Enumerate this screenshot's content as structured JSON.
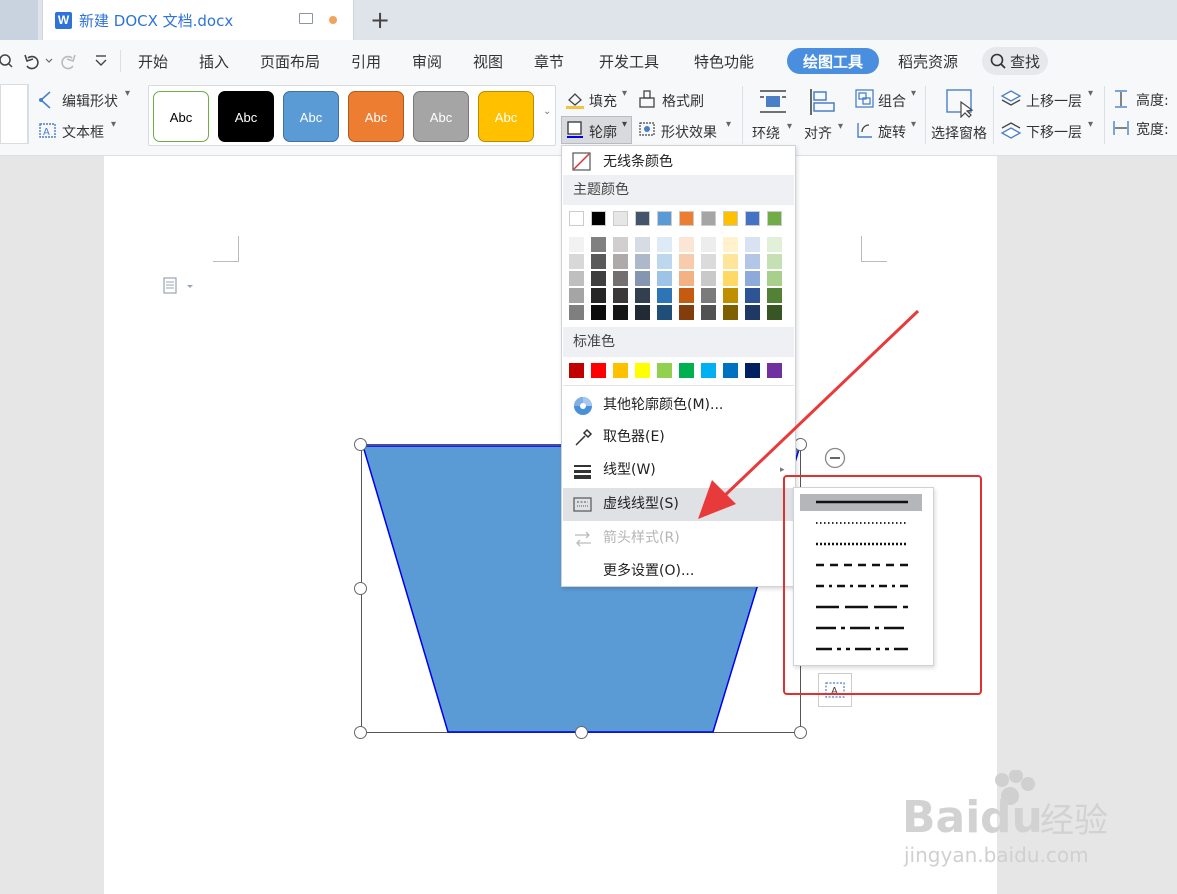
{
  "window": {
    "tab_title": "新建 DOCX 文档.docx",
    "new_tab_symbol": "+"
  },
  "menu": {
    "items": [
      "开始",
      "插入",
      "页面布局",
      "引用",
      "审阅",
      "视图",
      "章节",
      "开发工具",
      "特色功能",
      "绘图工具",
      "稻壳资源"
    ],
    "active": "绘图工具",
    "search_label": "查找"
  },
  "ribbon": {
    "edit_shape": "编辑形状",
    "text_box": "文本框",
    "style_label": "Abc",
    "fill": "填充",
    "format_painter": "格式刷",
    "outline": "轮廓",
    "shape_effect": "形状效果",
    "wrap": "环绕",
    "align": "对齐",
    "group": "组合",
    "rotate": "旋转",
    "selection_pane": "选择窗格",
    "bring_forward": "上移一层",
    "send_backward": "下移一层",
    "height": "高度:",
    "width": "宽度:"
  },
  "style_swatches": [
    {
      "bg": "#ffffff",
      "fg": "#000000",
      "border": "#70ad47"
    },
    {
      "bg": "#000000",
      "fg": "#ffffff",
      "border": "#000000"
    },
    {
      "bg": "#5b9bd5",
      "fg": "#ffffff",
      "border": "#41719c"
    },
    {
      "bg": "#ed7d31",
      "fg": "#ffffff",
      "border": "#ae5a21"
    },
    {
      "bg": "#a5a5a5",
      "fg": "#ffffff",
      "border": "#787878"
    },
    {
      "bg": "#ffc000",
      "fg": "#ffffff",
      "border": "#bc8c00"
    }
  ],
  "outline_menu": {
    "no_line": "无线条颜色",
    "theme_colors": "主题颜色",
    "standard_colors": "标准色",
    "more_colors": "其他轮廓颜色(M)...",
    "eyedropper": "取色器(E)",
    "line_type": "线型(W)",
    "dash_type": "虚线线型(S)",
    "arrow_style": "箭头样式(R)",
    "more_settings": "更多设置(O)..."
  },
  "theme_top": [
    "#ffffff",
    "#000000",
    "#e7e6e6",
    "#44546a",
    "#5b9bd5",
    "#ed7d31",
    "#a5a5a5",
    "#ffc000",
    "#4472c4",
    "#70ad47"
  ],
  "theme_shades": [
    [
      "#f2f2f2",
      "#808080",
      "#d0cece",
      "#d6dce4",
      "#deebf6",
      "#fbe5d5",
      "#ededed",
      "#fff2cc",
      "#d9e2f3",
      "#e2efd9"
    ],
    [
      "#d8d8d8",
      "#595959",
      "#aeaaaa",
      "#adb9ca",
      "#bdd7ee",
      "#f7cbac",
      "#dbdbdb",
      "#fee599",
      "#b4c6e7",
      "#c5e0b3"
    ],
    [
      "#bfbfbf",
      "#3f3f3f",
      "#757070",
      "#8496b0",
      "#9dc3e6",
      "#f4b183",
      "#c9c9c9",
      "#ffd966",
      "#8eaadb",
      "#a8d08d"
    ],
    [
      "#a5a5a5",
      "#262626",
      "#3a3838",
      "#323f4f",
      "#2e75b5",
      "#c55a11",
      "#7b7b7b",
      "#bf8f00",
      "#2f5496",
      "#538135"
    ],
    [
      "#7f7f7f",
      "#0c0c0c",
      "#171616",
      "#222a35",
      "#1f4e79",
      "#833c0b",
      "#525252",
      "#7f6000",
      "#1f3864",
      "#375623"
    ]
  ],
  "standard": [
    "#c00000",
    "#ff0000",
    "#ffc000",
    "#ffff00",
    "#92d050",
    "#00b050",
    "#00b0f0",
    "#0070c0",
    "#002060",
    "#7030a0"
  ],
  "shape": {
    "fill": "#5b9bd5",
    "stroke": "#0000ee"
  }
}
